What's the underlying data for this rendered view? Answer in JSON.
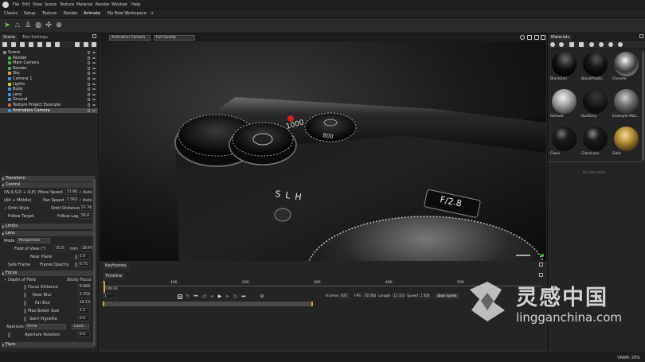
{
  "menu": [
    "File",
    "Edit",
    "View",
    "Scene",
    "Texture",
    "Material",
    "Render",
    "Window",
    "Help"
  ],
  "workspace_tabs": [
    "Classic",
    "Setup",
    "Texture",
    "Render",
    "Animate",
    "My New Workspace",
    "+"
  ],
  "scene_panel": {
    "tabs": [
      "Scene",
      "Tool Settings"
    ],
    "tree": [
      {
        "label": "Scene",
        "color": "#8a8a8a",
        "indent": 0
      },
      {
        "label": "Render",
        "color": "#4caf50",
        "indent": 1
      },
      {
        "label": "Main Camera",
        "color": "#4caf50",
        "indent": 1
      },
      {
        "label": "Render",
        "color": "#4caf50",
        "indent": 1
      },
      {
        "label": "Sky",
        "color": "#e0a040",
        "indent": 1
      },
      {
        "label": "Camera 1",
        "color": "#4a90d9",
        "indent": 1
      },
      {
        "label": "Lights",
        "color": "#e0c040",
        "indent": 1
      },
      {
        "label": "Body",
        "color": "#4a90d9",
        "indent": 1
      },
      {
        "label": "Lens",
        "color": "#4a90d9",
        "indent": 1
      },
      {
        "label": "Ground",
        "color": "#4a90d9",
        "indent": 1
      },
      {
        "label": "Texture Project Example",
        "color": "#d06050",
        "indent": 1
      },
      {
        "label": "Animation Camera",
        "color": "#4a90d9",
        "indent": 1,
        "selected": true
      }
    ]
  },
  "properties": {
    "transform": "Transform",
    "control": "Control",
    "wasd": "(W,A,S,D + Q,E)",
    "move_speed_label": "Move Speed",
    "move_speed": "11.84",
    "auto1": "Auto",
    "alt_middle": "(Alt + Middle)",
    "pan_speed_label": "Pan Speed",
    "pan_speed": "1.563",
    "auto2": "Auto",
    "orbit_style": "Orbit Style",
    "orbit_distance_label": "Orbit Distance",
    "orbit_distance": "22.34",
    "follow_target": "Follow Target",
    "follow_lag_label": "Follow Lag",
    "follow_lag": "56.8",
    "limits": "Limits",
    "lens": "Lens",
    "mode_label": "Mode",
    "mode": "Perspective",
    "fov_label": "Field of View (°)",
    "fov": "35.8",
    "mm_label": "mm",
    "mm": "28.97",
    "near_plane_label": "Near Plane",
    "near_plane": "1.0",
    "safe_frame": "Safe Frame",
    "frame_opacity_label": "Frame Opacity",
    "frame_opacity": "0.75",
    "focus": "Focus",
    "dof": "Depth of Field",
    "sticky_focus": "Sticky Focus",
    "focus_distance_label": "Focus Distance",
    "focus_distance": "8.866",
    "near_blur_label": "Near Blur",
    "near_blur": "2.252",
    "far_blur_label": "Far Blur",
    "far_blur": "16.13",
    "max_bokeh_label": "Max Bokeh Size",
    "max_bokeh": "1.5",
    "swirl_label": "Swirl Vignette",
    "swirl": "0.0",
    "aperture_label": "Aperture",
    "aperture": "Circle",
    "load": "Load...",
    "aperture_rotation_label": "Aperture Rotation",
    "aperture_rotation": "0.0",
    "flare": "Flare"
  },
  "viewport": {
    "camera": "Animation Camera",
    "quality": "Full Quality",
    "lens_text": "F/2.8",
    "body_text": "SLH",
    "dial_text_1": "1000",
    "dial_text_2": "800"
  },
  "timeline": {
    "keyframes_tab": "Keyframes",
    "timeline_tab": "Timeline",
    "timecode": "0:00.01",
    "frame_field": "1",
    "frames_label": "Frames",
    "frames": "400",
    "fps_label": "FPS",
    "fps": "30.000",
    "length_label": "Length",
    "length": "13.333",
    "speed_label": "Speed",
    "speed": "1.000",
    "bake_speed": "Bake Speed",
    "ruler_marks": [
      "0",
      "100",
      "200",
      "300",
      "400",
      "500"
    ]
  },
  "materials": {
    "tab": "Materials",
    "items": [
      {
        "name": "BlackDial",
        "fill": "radial-gradient(circle at 55% 30%,#6a6a6a 0%,#111 45%,#000 75%)"
      },
      {
        "name": "BlackPlastic",
        "fill": "radial-gradient(circle at 55% 30%,#555 0%,#151515 40%,#050505 75%)"
      },
      {
        "name": "Chrome",
        "fill": "radial-gradient(circle at 45% 35%,#fff 0%,#aaa 20%,#333 55%,#888 80%,#222 100%)"
      },
      {
        "name": "Default",
        "fill": "radial-gradient(circle at 45% 35%,#f0f0f0 0%,#aaa 35%,#555 70%,#2a2a2a 100%)"
      },
      {
        "name": "DullGrey",
        "fill": "radial-gradient(circle at 55% 30%,#3a3a3a 0%,#111 55%,#050505 100%)"
      },
      {
        "name": "Example Mat...",
        "fill": "radial-gradient(circle at 45% 35%,#cfcfcf 0%,#777 35%,#2c2c2c 75%,#111 100%)"
      },
      {
        "name": "Glass",
        "fill": "radial-gradient(circle at 40% 30%,#777 0%,#1a1a1a 30%,#0a0a0a 80%)"
      },
      {
        "name": "GlassLens",
        "fill": "radial-gradient(circle at 40% 30%,#888 0%,#1a1a1a 30%,#0a0a0a 80%)"
      },
      {
        "name": "Gold",
        "fill": "radial-gradient(circle at 45% 35%,#f2dc9a 0%,#b8923c 35%,#5a4316 70%,#2a1e08 100%)"
      }
    ],
    "no_selection": "No Selection"
  },
  "status": {
    "vram": "VRAM: 29%"
  },
  "watermark": {
    "cn": "灵感中国",
    "url": "lingganchina.com"
  }
}
